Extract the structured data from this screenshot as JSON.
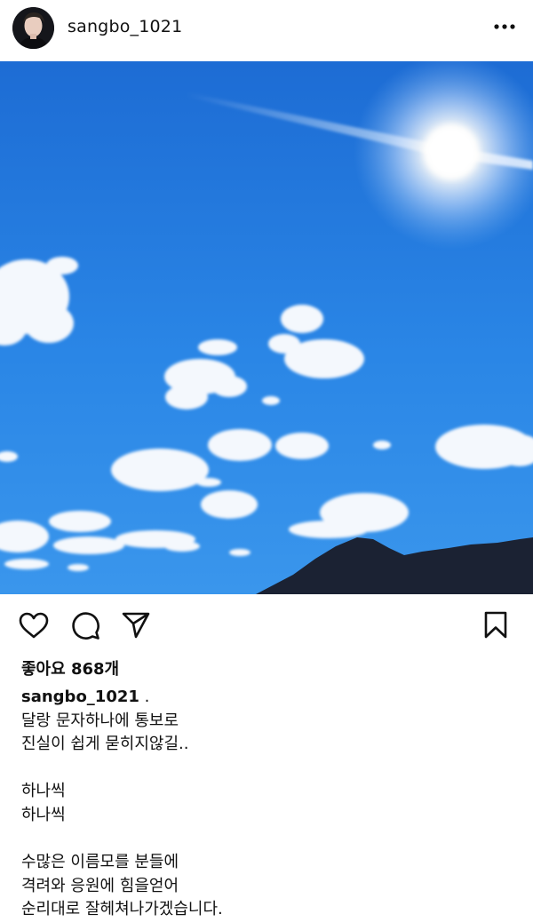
{
  "post": {
    "username": "sangbo_1021",
    "likes_text": "좋아요 868개",
    "caption_username": "sangbo_1021",
    "caption_suffix": " .",
    "caption_lines": [
      "달랑 문자하나에 통보로",
      "진실이 쉽게 묻히지않길..",
      "",
      "하나씩",
      "하나씩",
      "",
      "수많은 이름모를 분들에",
      "격려와 응원에 힘을얻어",
      "순리대로 잘헤쳐나가겠습니다."
    ]
  },
  "icons": {
    "more": "more-horizontal-icon",
    "like": "heart-icon",
    "comment": "comment-icon",
    "share": "send-icon",
    "save": "bookmark-icon"
  },
  "colors": {
    "sky_top": "#1e6fd6",
    "sky_bottom": "#2f8ce8",
    "mountain": "#1c2233",
    "text": "#111111"
  }
}
